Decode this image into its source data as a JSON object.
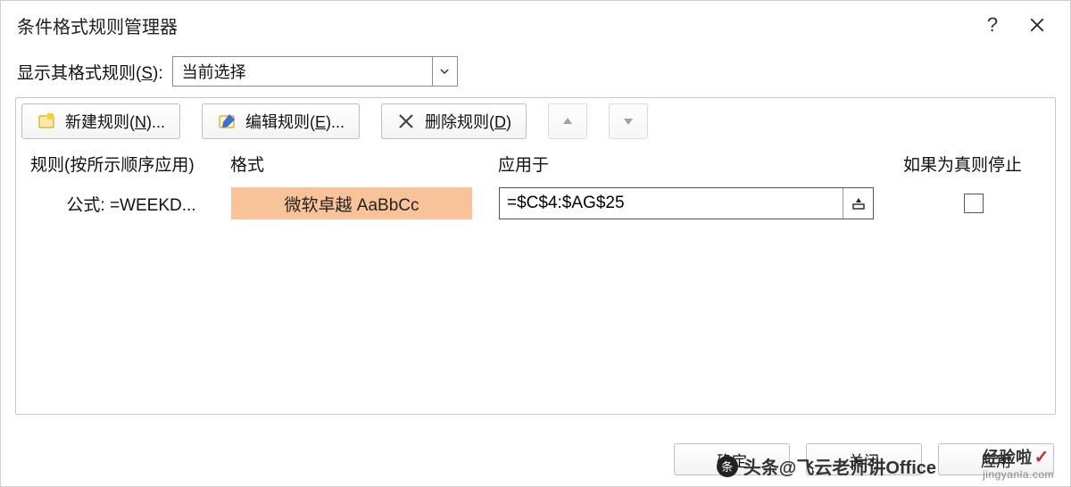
{
  "titlebar": {
    "title": "条件格式规则管理器",
    "help_label": "?",
    "close_label": "×"
  },
  "scope": {
    "label_prefix": "显示其格式规则(",
    "label_mn": "S",
    "label_suffix": "):",
    "selected": "当前选择"
  },
  "toolbar": {
    "new_rule": {
      "prefix": "新建规则(",
      "mn": "N",
      "suffix": ")..."
    },
    "edit_rule": {
      "prefix": "编辑规则(",
      "mn": "E",
      "suffix": ")..."
    },
    "delete_rule": {
      "prefix": "删除规则(",
      "mn": "D",
      "suffix": ")"
    }
  },
  "columns": {
    "rule": "规则(按所示顺序应用)",
    "format": "格式",
    "applies_to": "应用于",
    "stop_if_true": "如果为真则停止"
  },
  "rules": [
    {
      "name": "公式: =WEEKD...",
      "format_sample": "微软卓越 AaBbCc",
      "applies_to": "=$C$4:$AG$25",
      "stop_if_true": false
    }
  ],
  "footer": {
    "ok": "确定",
    "close": "关闭",
    "apply": "应用"
  },
  "watermark": {
    "text": "头条@飞云老师讲Office",
    "site_prefix": "经验啦",
    "site": "jingyanla.com"
  }
}
